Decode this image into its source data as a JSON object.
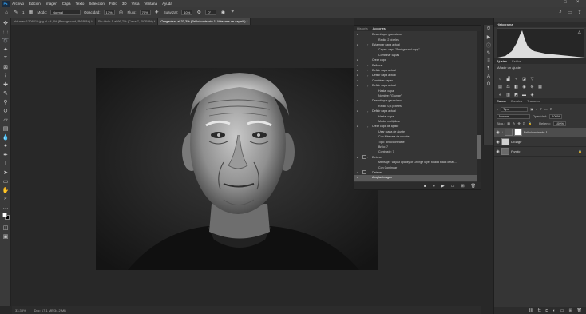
{
  "menu": {
    "logo": "Ps",
    "items": [
      "Archivo",
      "Edición",
      "Imagen",
      "Capa",
      "Texto",
      "Selección",
      "Filtro",
      "3D",
      "Vista",
      "Ventana",
      "Ayuda"
    ]
  },
  "options": {
    "mode_label": "Modo:",
    "mode_value": "Normal",
    "opacity_label": "Opacidad:",
    "opacity_value": "17%",
    "flow_label": "Flujo:",
    "flow_value": "70%",
    "smooth_label": "Suavizar:",
    "smooth_value": "10%",
    "brush_size": "1",
    "angle_value": "0°"
  },
  "tabs": [
    {
      "label": "old-man-1208210.jpg al 44,8% (Background, RGB/8#) *",
      "active": false
    },
    {
      "label": "Sin título-1 al 66,7% (Capa 7, RGB/8#) *",
      "active": false
    },
    {
      "label": "Oraganizar al 33,3% (Brillo/contraste 1, Máscara de capa/8) *",
      "active": true
    }
  ],
  "status": {
    "zoom": "33,33%",
    "doc": "Doc: 17,1 MB/34,2 MB"
  },
  "actions_panel": {
    "tabs": [
      "Historia",
      "Acciones"
    ],
    "active_tab": "Acciones",
    "rows": [
      {
        "check": true,
        "dialog": false,
        "expand": "",
        "text": "Desenfoque gaussiano",
        "indent": 0
      },
      {
        "check": false,
        "dialog": false,
        "expand": "",
        "text": "Radio: 2 píxeles",
        "indent": 1
      },
      {
        "check": true,
        "dialog": false,
        "expand": "›",
        "text": "Estampar capa actual",
        "indent": 0
      },
      {
        "check": false,
        "dialog": false,
        "expand": "",
        "text": "Capas: capa \"Background copy\"",
        "indent": 1
      },
      {
        "check": false,
        "dialog": false,
        "expand": "",
        "text": "Combinar capas",
        "indent": 1
      },
      {
        "check": true,
        "dialog": false,
        "expand": "",
        "text": "Crear capa",
        "indent": 0
      },
      {
        "check": true,
        "dialog": false,
        "expand": "›",
        "text": "Rellenar",
        "indent": 0
      },
      {
        "check": true,
        "dialog": false,
        "expand": "›",
        "text": "Definir capa actual",
        "indent": 0
      },
      {
        "check": true,
        "dialog": false,
        "expand": "›",
        "text": "Definir capa actual",
        "indent": 0
      },
      {
        "check": true,
        "dialog": false,
        "expand": "",
        "text": "Combinar capas",
        "indent": 0
      },
      {
        "check": true,
        "dialog": false,
        "expand": "›",
        "text": "Definir capa actual",
        "indent": 0
      },
      {
        "check": false,
        "dialog": false,
        "expand": "",
        "text": "Hasta: capa",
        "indent": 1
      },
      {
        "check": false,
        "dialog": false,
        "expand": "",
        "text": "Nombre: \"Grunge\"",
        "indent": 1
      },
      {
        "check": true,
        "dialog": false,
        "expand": "",
        "text": "Desenfoque gaussiano",
        "indent": 0
      },
      {
        "check": false,
        "dialog": false,
        "expand": "",
        "text": "Radio: 0,3 píxeles",
        "indent": 1
      },
      {
        "check": true,
        "dialog": false,
        "expand": "›",
        "text": "Definir capa actual",
        "indent": 0
      },
      {
        "check": false,
        "dialog": false,
        "expand": "",
        "text": "Hasta: capa",
        "indent": 1
      },
      {
        "check": false,
        "dialog": false,
        "expand": "",
        "text": "Modo: multiplicar",
        "indent": 1
      },
      {
        "check": true,
        "dialog": false,
        "expand": "›",
        "text": "Crear capa de ajuste",
        "indent": 0
      },
      {
        "check": false,
        "dialog": false,
        "expand": "",
        "text": "Usar: capa de ajuste",
        "indent": 1
      },
      {
        "check": false,
        "dialog": false,
        "expand": "",
        "text": "Con Máscara de recorte",
        "indent": 1
      },
      {
        "check": false,
        "dialog": false,
        "expand": "",
        "text": "Tipo: Brillo/contraste",
        "indent": 1
      },
      {
        "check": false,
        "dialog": false,
        "expand": "",
        "text": "Brillo: 7",
        "indent": 1
      },
      {
        "check": false,
        "dialog": false,
        "expand": "",
        "text": "Contraste: 7",
        "indent": 1
      },
      {
        "check": true,
        "dialog": true,
        "expand": "›",
        "text": "Detener",
        "indent": 0
      },
      {
        "check": false,
        "dialog": false,
        "expand": "",
        "text": "Mensaje: \"Adjust opacity of Grunge layer to add black detail...",
        "indent": 1
      },
      {
        "check": false,
        "dialog": false,
        "expand": "",
        "text": "Con Continuar",
        "indent": 1
      },
      {
        "check": true,
        "dialog": true,
        "expand": "",
        "text": "Detener",
        "indent": 0
      },
      {
        "check": true,
        "dialog": false,
        "expand": "",
        "text": "Acoplar imagen",
        "indent": 0,
        "selected": true
      }
    ]
  },
  "histogram": {
    "tabs": [
      "Histograma"
    ],
    "warning": "⚠"
  },
  "adjust_panel": {
    "tabs": [
      "Ajustes",
      "Estilos"
    ],
    "subtitle": "Añadir un ajuste"
  },
  "layers_panel": {
    "tabs": [
      "Capas",
      "Canales",
      "Trazados"
    ],
    "filter_label": "Tipo",
    "blend_mode": "Normal",
    "opacity_label": "Opacidad:",
    "opacity_value": "100%",
    "lock_label": "Bloq.:",
    "fill_label": "Relleno:",
    "fill_value": "100%",
    "layers": [
      {
        "name": "Brillo/contraste 1",
        "selected": true,
        "adjustment": true
      },
      {
        "name": "Grunge",
        "selected": false,
        "adjustment": false
      },
      {
        "name": "Fondo",
        "selected": false,
        "adjustment": false
      }
    ]
  }
}
